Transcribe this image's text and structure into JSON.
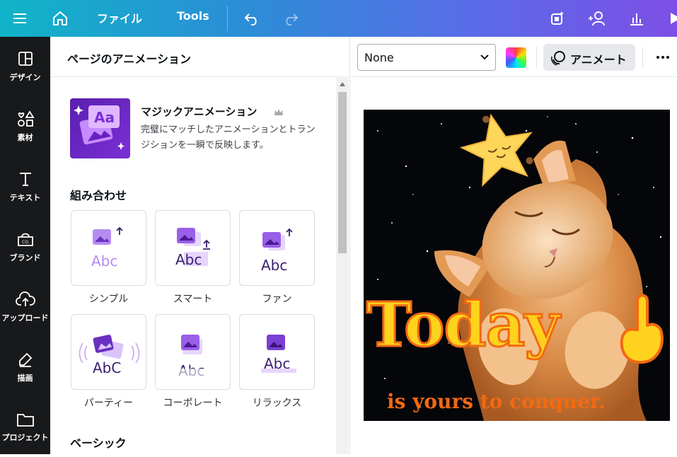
{
  "topbar": {
    "file_label": "ファイル",
    "tools_label": "Tools"
  },
  "sidebar": {
    "items": [
      {
        "label": "デザイン",
        "icon": "layout-icon"
      },
      {
        "label": "素材",
        "icon": "elements-icon"
      },
      {
        "label": "テキスト",
        "icon": "text-icon"
      },
      {
        "label": "ブランド",
        "icon": "brand-icon"
      },
      {
        "label": "アップロード",
        "icon": "upload-icon"
      },
      {
        "label": "描画",
        "icon": "draw-icon"
      },
      {
        "label": "プロジェクト",
        "icon": "folder-icon"
      }
    ]
  },
  "panel": {
    "title": "ページのアニメーション",
    "magic": {
      "title": "マジックアニメーション",
      "description": "完璧にマッチしたアニメーションとトランジションを一瞬で反映します。"
    },
    "combo_section": "組み合わせ",
    "combo_cards": [
      "シンプル",
      "スマート",
      "ファン",
      "パーティー",
      "コーポレート",
      "リラックス"
    ],
    "basic_section": "ベーシック"
  },
  "context_bar": {
    "select_value": "None",
    "animate_label": "アニメート"
  },
  "design": {
    "headline": "Today",
    "subline": "is yours to conquer."
  },
  "colors": {
    "accent_purple": "#7b2fd6",
    "headline_yellow": "#ffd21e",
    "headline_orange": "#f26a12"
  }
}
